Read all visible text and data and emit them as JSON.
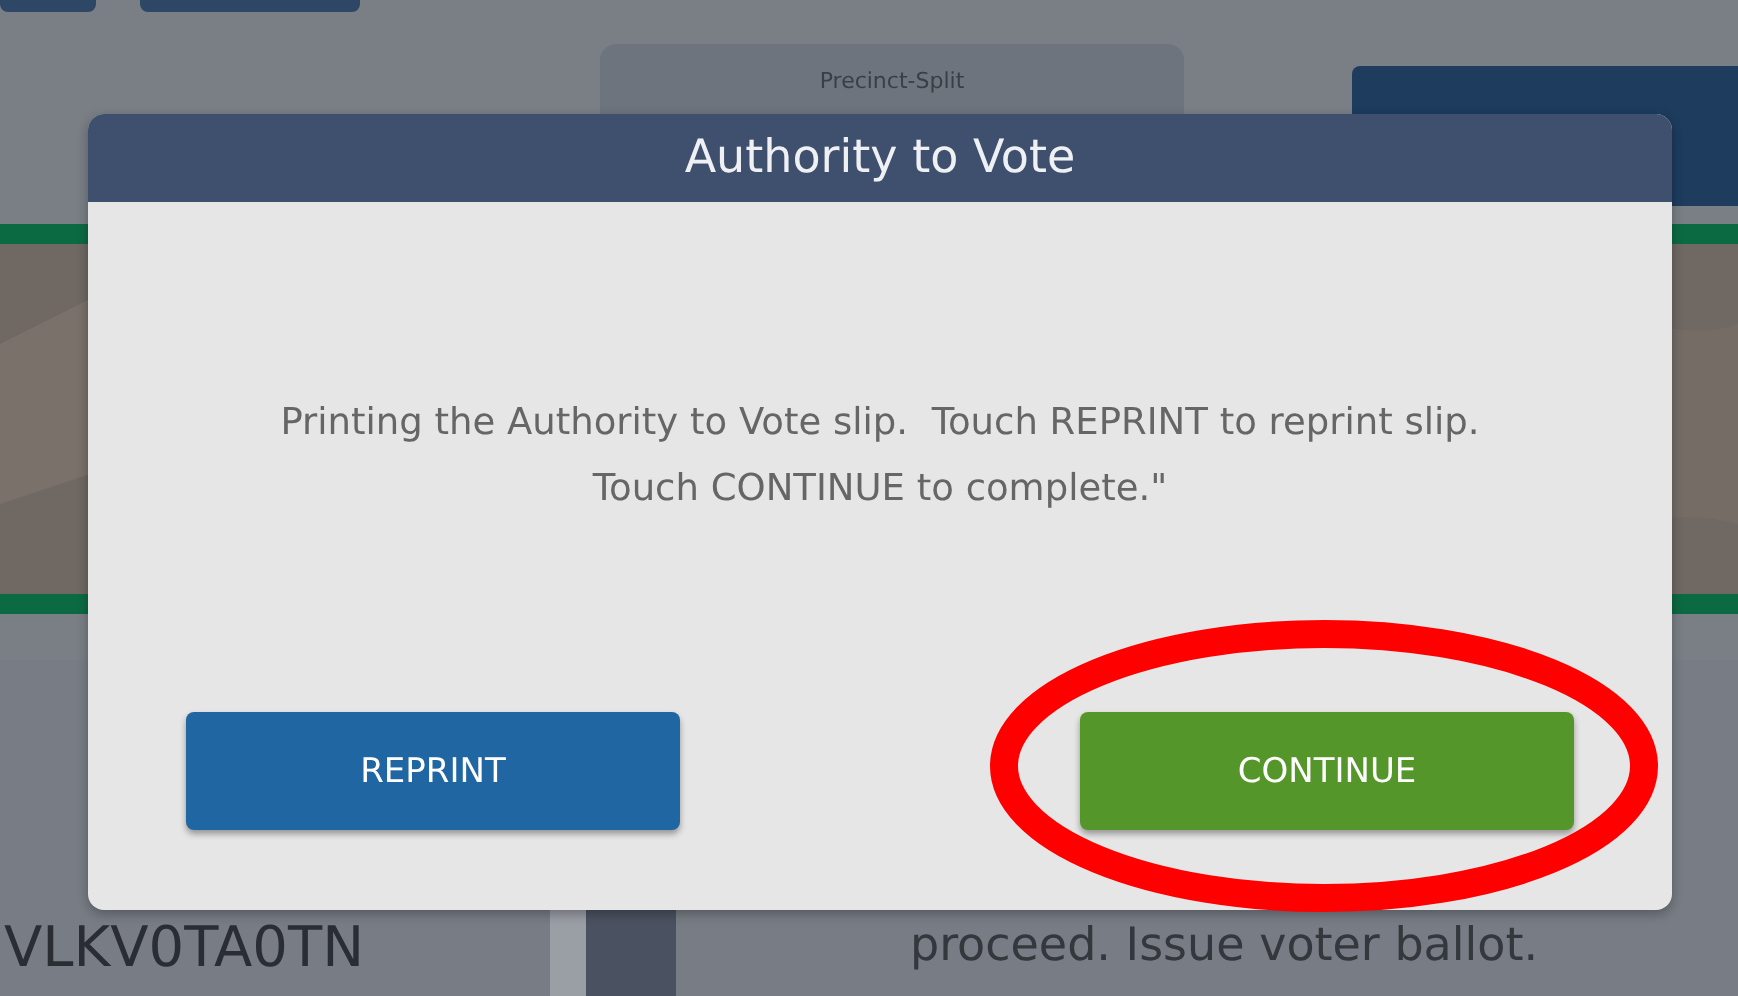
{
  "background": {
    "precinct_label": "Precinct-Split",
    "voter_id": "VLKV0TA0TN",
    "instruction": "proceed. Issue voter ballot."
  },
  "dialog": {
    "title": "Authority to Vote",
    "message": "Printing the Authority to Vote slip.  Touch REPRINT to reprint slip.  Touch CONTINUE to complete.\"",
    "buttons": [
      {
        "label": "REPRINT",
        "kind": "primary"
      },
      {
        "label": "CONTINUE",
        "kind": "success"
      }
    ]
  }
}
